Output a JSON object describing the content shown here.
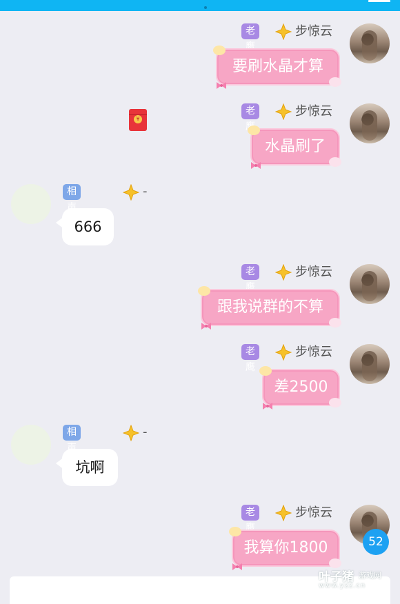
{
  "header": {
    "accent": "#0fb5f3"
  },
  "messages": [
    {
      "side": "self",
      "title": "老鹰",
      "nickname": "步惊云",
      "text": "要刷水晶才算"
    },
    {
      "side": "self",
      "title": "老鹰",
      "nickname": "步惊云",
      "text": "水晶刷了"
    },
    {
      "side": "other",
      "title": "相声演员",
      "nickname": "-",
      "text": "666"
    },
    {
      "side": "self",
      "title": "老鹰",
      "nickname": "步惊云",
      "text": "跟我说群的不算"
    },
    {
      "side": "self",
      "title": "老鹰",
      "nickname": "步惊云",
      "text": "差2500"
    },
    {
      "side": "other",
      "title": "相声演员",
      "nickname": "-",
      "text": "坑啊"
    },
    {
      "side": "self",
      "title": "老鹰",
      "nickname": "步惊云",
      "text": "我算你1800"
    }
  ],
  "red_packet": {
    "icon": "red-envelope-icon",
    "symbol": "¥"
  },
  "unread_count": "52",
  "watermark": {
    "title": "叶子猪",
    "tag": "游戏网",
    "url": "www.yzz.cn"
  },
  "colors": {
    "self_bubble": "#f7a6c5",
    "other_bubble": "#ffffff",
    "title_purple": "#a889e4",
    "title_blue": "#7ea7e8",
    "unread_badge": "#1da1f2"
  }
}
